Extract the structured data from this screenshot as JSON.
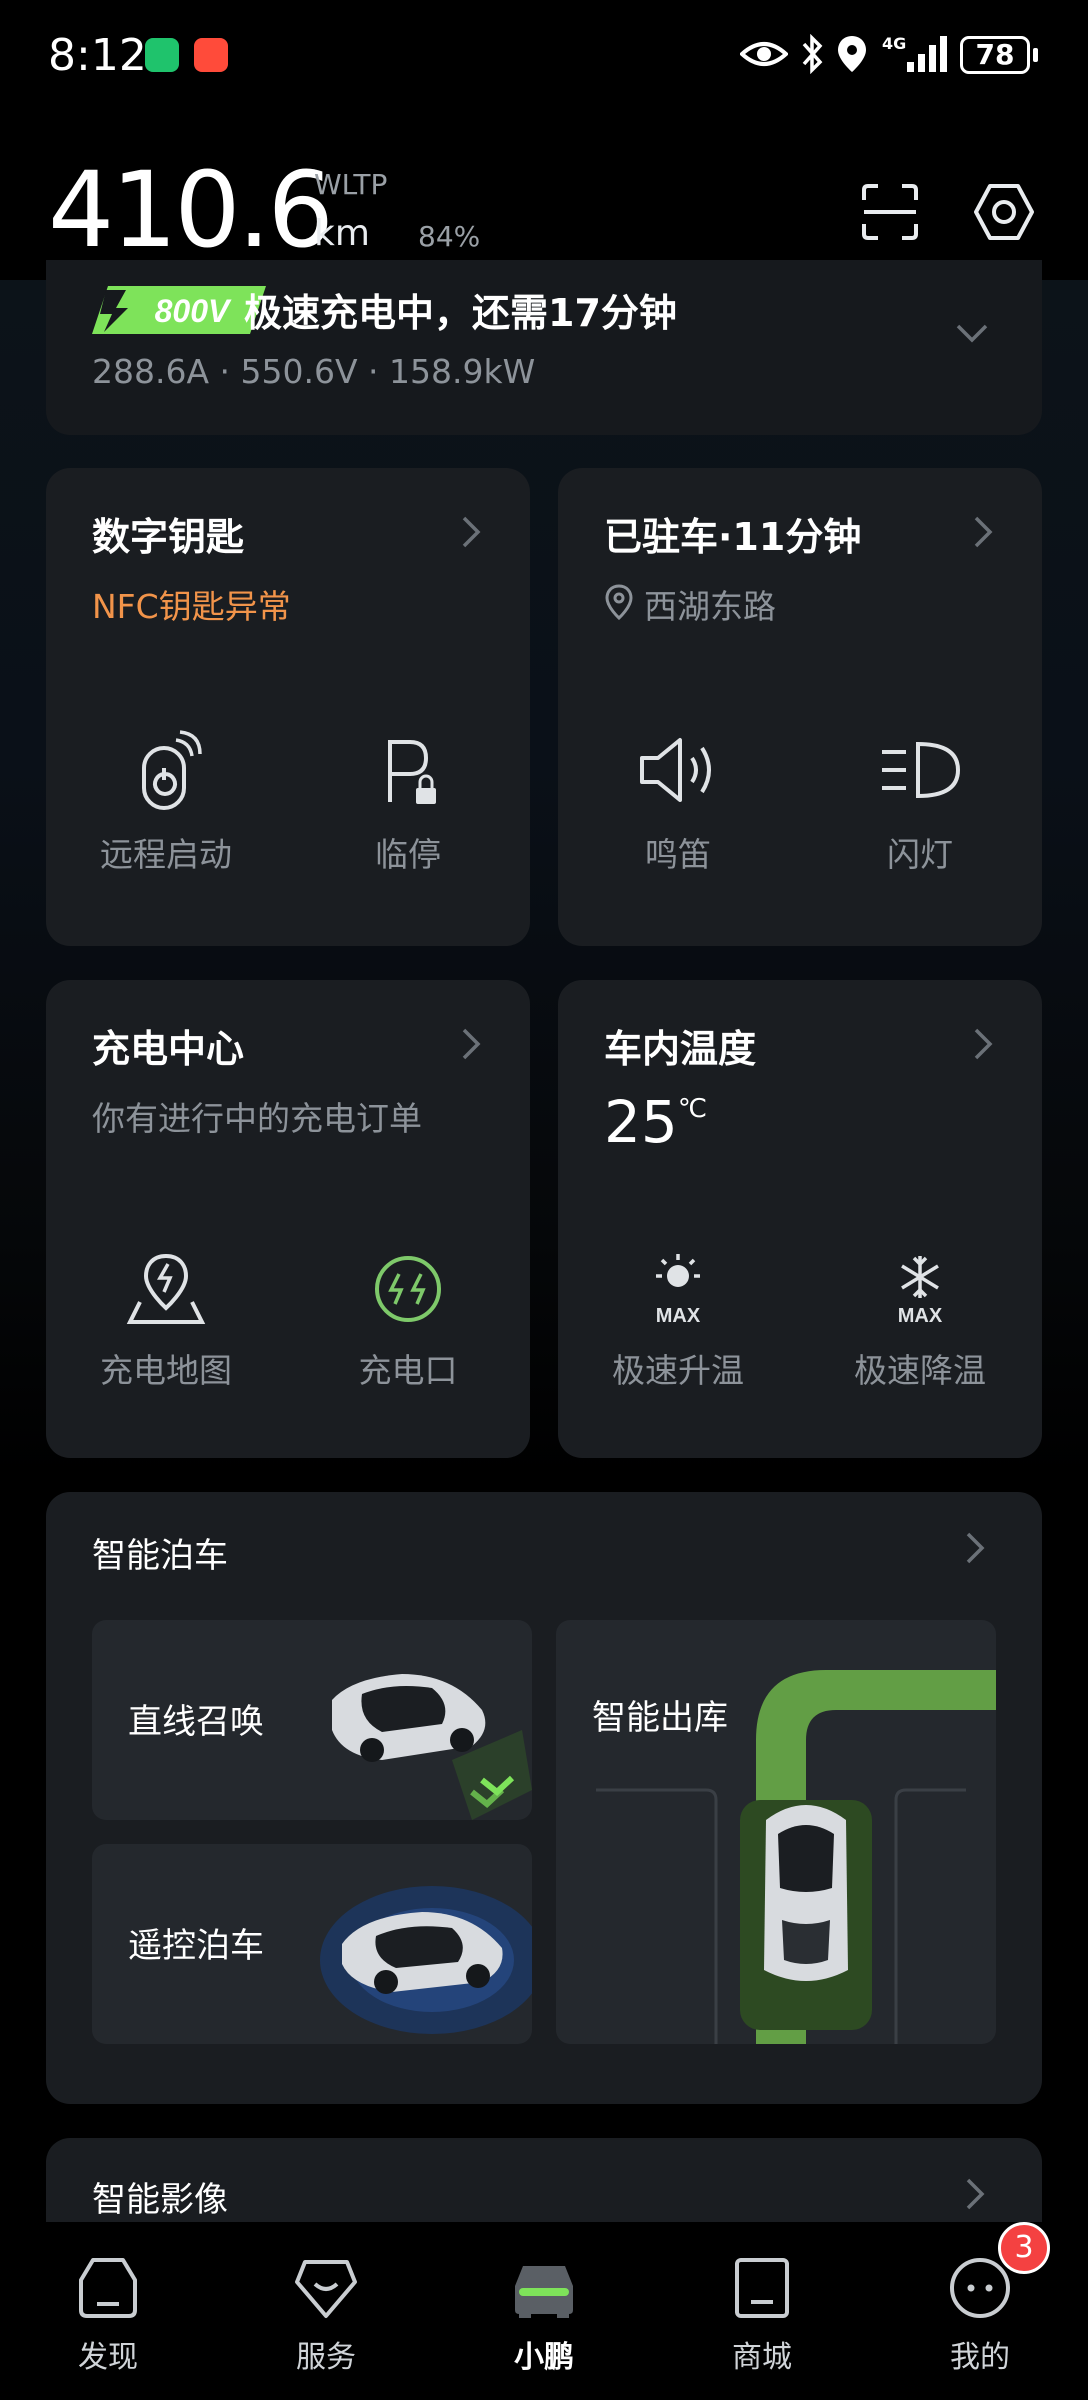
{
  "status_bar": {
    "time": "8:12",
    "network": "4G",
    "battery": "78"
  },
  "header": {
    "range_value": "410.6",
    "range_standard": "WLTP",
    "range_unit": "km",
    "battery_percent": "84%"
  },
  "charging": {
    "voltage_badge": "800V",
    "status": "极速充电中，还需17分钟",
    "stats": "288.6A · 550.6V · 158.9kW"
  },
  "digital_key": {
    "title": "数字钥匙",
    "warning": "NFC钥匙异常",
    "actions": [
      {
        "label": "远程启动",
        "icon": "remote-start-icon"
      },
      {
        "label": "临停",
        "icon": "temp-park-icon"
      }
    ]
  },
  "parking": {
    "title": "已驻车·11分钟",
    "location": "西湖东路",
    "actions": [
      {
        "label": "鸣笛",
        "icon": "horn-icon"
      },
      {
        "label": "闪灯",
        "icon": "headlight-icon"
      }
    ]
  },
  "charging_center": {
    "title": "充电中心",
    "subtitle": "你有进行中的充电订单",
    "actions": [
      {
        "label": "充电地图",
        "icon": "charge-map-icon"
      },
      {
        "label": "充电口",
        "icon": "charge-port-icon"
      }
    ]
  },
  "cabin_temp": {
    "title": "车内温度",
    "value": "25",
    "unit": "℃",
    "actions": [
      {
        "label": "极速升温",
        "icon": "heat-max-icon",
        "badge": "MAX"
      },
      {
        "label": "极速降温",
        "icon": "cool-max-icon",
        "badge": "MAX"
      }
    ]
  },
  "smart_parking": {
    "title": "智能泊车",
    "tiles": [
      {
        "label": "直线召唤"
      },
      {
        "label": "遥控泊车"
      },
      {
        "label": "智能出库"
      }
    ]
  },
  "smart_camera": {
    "title": "智能影像"
  },
  "bottom_nav": {
    "items": [
      {
        "label": "发现",
        "icon": "discover-icon"
      },
      {
        "label": "服务",
        "icon": "service-icon"
      },
      {
        "label": "小鹏",
        "icon": "car-icon",
        "active": true
      },
      {
        "label": "商城",
        "icon": "mall-icon"
      },
      {
        "label": "我的",
        "icon": "profile-icon"
      }
    ],
    "profile_badge": "3"
  },
  "colors": {
    "accent_green": "#7ee35a",
    "warning_orange": "#f2944a",
    "card_bg": "#1a1d21",
    "badge_red": "#f44141"
  }
}
